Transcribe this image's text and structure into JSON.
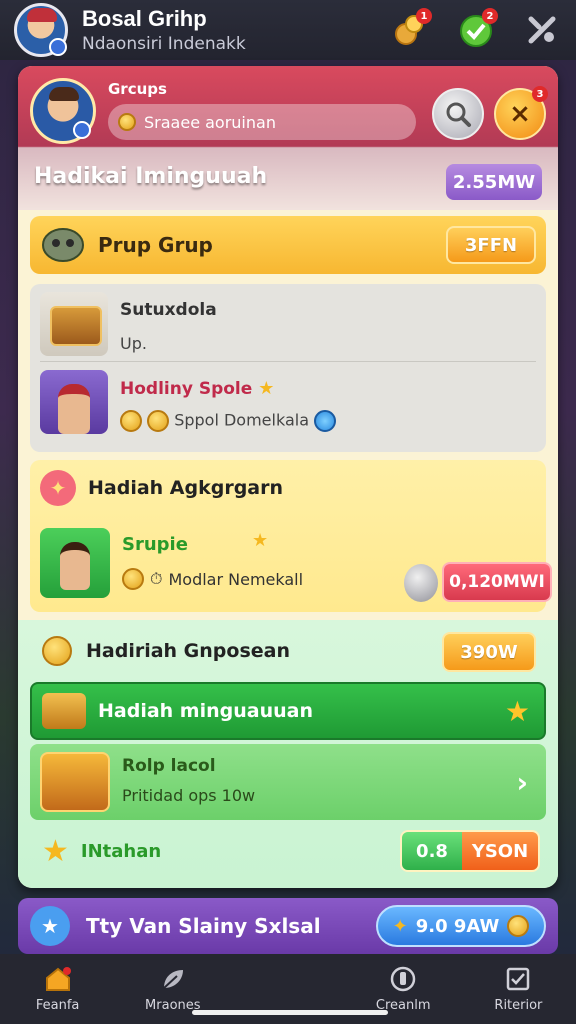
{
  "topbar": {
    "title": "Bosal Grihp",
    "subtitle": "Ndaonsiri Indenakk",
    "icons": [
      {
        "name": "coins-icon",
        "badge": "1"
      },
      {
        "name": "check-shield-icon",
        "badge": "2"
      },
      {
        "name": "settings-icon",
        "badge": ""
      }
    ]
  },
  "header": {
    "groups_label": "Grcups",
    "search_placeholder": "Sraaee aoruinan",
    "close_badge": "3",
    "title": "Hadikai Iminguuah",
    "value": "2.55MW"
  },
  "section1": {
    "bar": {
      "label": "Prup Grup",
      "value": "3FFN"
    },
    "rows": [
      {
        "title": "Sutuxdola",
        "sub": "Up."
      },
      {
        "title": "Hodliny Spole",
        "sub": "Sppol Domelkala"
      }
    ],
    "card": {
      "title": "Hadiah Agkgrgarn",
      "name": "Srupie",
      "sub": "Modlar Nemekall",
      "value": "0,120MWI"
    }
  },
  "section2": {
    "head": {
      "label": "Hadiriah Gnposean",
      "value": "390W"
    },
    "green_bar": {
      "label": "Hadiah minguauuan"
    },
    "item": {
      "title": "Rolp lacol",
      "sub": "Pritidad ops 10w"
    },
    "foot": {
      "label": "INtahan",
      "value_a": "0.8",
      "value_b": "YSON"
    }
  },
  "purple_bar": {
    "label": "Tty Van Slainy Sxlsal",
    "value": "9.0 9AW"
  },
  "nav": [
    {
      "label": "Feanfa",
      "icon": "home-icon"
    },
    {
      "label": "Mraones",
      "icon": "leaf-icon"
    },
    {
      "label": "",
      "icon": ""
    },
    {
      "label": "Creanlm",
      "icon": "shield-icon"
    },
    {
      "label": "Riterior",
      "icon": "checkbox-icon"
    }
  ],
  "colors": {
    "accent_red": "#d94a5e",
    "accent_yellow": "#f7b731",
    "accent_green": "#1f9a34",
    "accent_purple": "#6a3aa8",
    "accent_blue": "#2a7ae0"
  }
}
